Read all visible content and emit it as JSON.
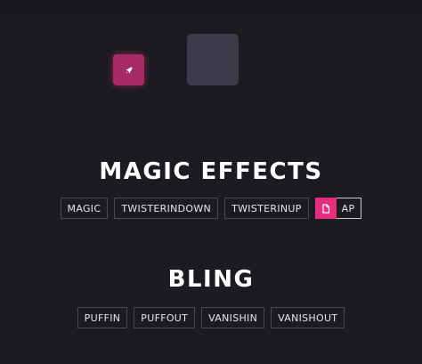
{
  "sections": {
    "magic": {
      "title": "MAGIC EFFECTS",
      "buttons": [
        "MAGIC",
        "TWISTERINDOWN",
        "TWISTERINUP",
        "AP"
      ]
    },
    "bling": {
      "title": "BLING",
      "buttons": [
        "PUFFIN",
        "PUFFOUT",
        "VANISHIN",
        "VANISHOUT"
      ]
    }
  },
  "icons": {
    "tile_icon": "rocket-icon",
    "active_button_icon": "document-icon"
  },
  "colors": {
    "background": "#1c1b21",
    "accent_pink": "#e62e7d",
    "tile_pink": "#a62a63",
    "tile_gray": "#3b3b49"
  }
}
